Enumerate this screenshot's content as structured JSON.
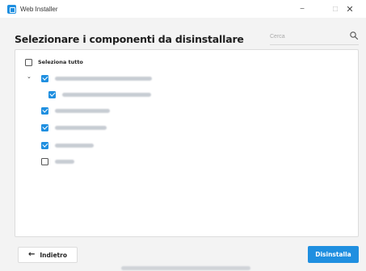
{
  "window": {
    "title": "Web Installer",
    "minimize_glyph": "−",
    "maximize_glyph": "□",
    "close_glyph": "✕"
  },
  "header": {
    "title": "Selezionare i componenti da disinstallare"
  },
  "search": {
    "placeholder": "Cerca",
    "icon": "search-icon"
  },
  "components": {
    "select_all": {
      "label": "Seleziona tutto",
      "checked": false
    },
    "expand_glyph": "⌄",
    "items": [
      {
        "checked": true,
        "level": 0,
        "label_obscured": true
      },
      {
        "checked": true,
        "level": 1,
        "label_obscured": true
      },
      {
        "checked": true,
        "level": 0,
        "label_obscured": true
      },
      {
        "checked": true,
        "level": 0,
        "label_obscured": true
      },
      {
        "checked": true,
        "level": 0,
        "label_obscured": true
      },
      {
        "checked": false,
        "level": 0,
        "label_obscured": true
      }
    ]
  },
  "footer": {
    "back_label": "Indietro",
    "back_icon": "arrow-left-icon",
    "uninstall_label": "Disinstalla",
    "copyright_obscured": true
  },
  "colors": {
    "accent": "#1f8fe0",
    "background": "#f3f3f3",
    "panel": "#ffffff"
  }
}
